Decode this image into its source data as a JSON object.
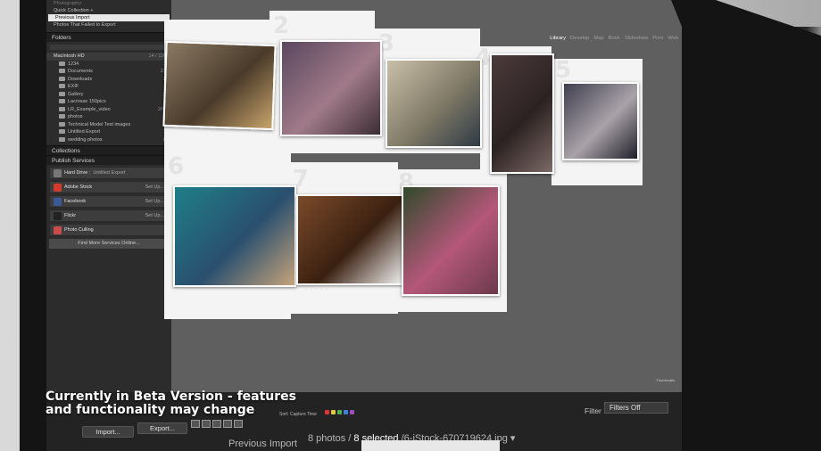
{
  "app": {
    "top_lines": [
      "Photography",
      "Quick Collection +",
      "Previous Import",
      "Photos That Failed to Export"
    ],
    "modules": [
      "Library",
      "Develop",
      "Map",
      "Book",
      "Slideshow",
      "Print",
      "Web"
    ],
    "active_module": "Library"
  },
  "folders": {
    "title": "Folders",
    "disk": {
      "name": "Macintosh HD",
      "size": "14 / 116"
    },
    "items": [
      {
        "name": "1234",
        "count": "3"
      },
      {
        "name": "Documents",
        "count": "23"
      },
      {
        "name": "Downloads",
        "count": "2"
      },
      {
        "name": "EXIF",
        "count": "3"
      },
      {
        "name": "Gallery",
        "count": "1"
      },
      {
        "name": "Lacrosse 150pics",
        "count": "4"
      },
      {
        "name": "LR_Example_video",
        "count": "201"
      },
      {
        "name": "photos",
        "count": "1"
      },
      {
        "name": "Technical Model Test images",
        "count": "8"
      },
      {
        "name": "Untitled Export",
        "count": "1"
      },
      {
        "name": "wedding photos",
        "count": "8"
      }
    ]
  },
  "collections": {
    "title": "Collections"
  },
  "publish": {
    "title": "Publish Services",
    "services": [
      {
        "name": "Hard Drive :",
        "sub": "Untitled Export",
        "action": "",
        "color": "#777777"
      },
      {
        "name": "Adobe Stock",
        "sub": "",
        "action": "Set Up...",
        "color": "#d23a2c"
      },
      {
        "name": "Facebook",
        "sub": "",
        "action": "Set Up...",
        "color": "#3b5998"
      },
      {
        "name": "Flickr",
        "sub": "",
        "action": "Set Up...",
        "color": "#222222"
      },
      {
        "name": "Photo Culling",
        "sub": "",
        "action": "",
        "color": "#c94b4b"
      }
    ],
    "find_more": "Find More Services Online..."
  },
  "grid": {
    "cell_numbers": [
      "2",
      "3",
      "4",
      "5",
      "6",
      "7",
      "8"
    ],
    "photos": [
      {
        "name": "couple-on-cliff",
        "colors": [
          "#8a7a64",
          "#4a3a2a",
          "#c7a46b"
        ]
      },
      {
        "name": "couple-by-car",
        "colors": [
          "#5a4860",
          "#a07a88",
          "#3b2c34"
        ]
      },
      {
        "name": "couple-in-field",
        "colors": [
          "#c9bfa9",
          "#807a66",
          "#2f3a45"
        ]
      },
      {
        "name": "couple-at-door",
        "colors": [
          "#4c3b3b",
          "#2c2222",
          "#7c6a66"
        ]
      },
      {
        "name": "couple-studio",
        "colors": [
          "#3f3f4f",
          "#a9a2a8",
          "#1f1f28"
        ]
      },
      {
        "name": "couple-blue-door",
        "colors": [
          "#1e7f88",
          "#2a4f6f",
          "#c6a37a"
        ]
      },
      {
        "name": "couple-on-floor",
        "colors": [
          "#7a4a2a",
          "#3a2010",
          "#f1f1f1"
        ]
      },
      {
        "name": "couple-flowers",
        "colors": [
          "#2f4a2a",
          "#b5577a",
          "#6a3a4a"
        ]
      }
    ]
  },
  "toolbar": {
    "import_label": "Import...",
    "export_label": "Export...",
    "sort_label": "Sort:",
    "sort_value": "Capture Time",
    "flag_colors": [
      "#d33",
      "#e6c63a",
      "#4caf50",
      "#3f7fd9",
      "#9a4fc4"
    ],
    "filter_label": "Filter :",
    "filter_value": "Filters Off"
  },
  "filmstrip": {
    "source": "Previous Import",
    "count": "8 photos /",
    "selected": "8 selected",
    "filename": "/6-iStock-670719624.jpg",
    "dropdown": "▾"
  },
  "overlay": {
    "line1": "Currently in Beta Version - features",
    "line2": "and functionality may change"
  }
}
